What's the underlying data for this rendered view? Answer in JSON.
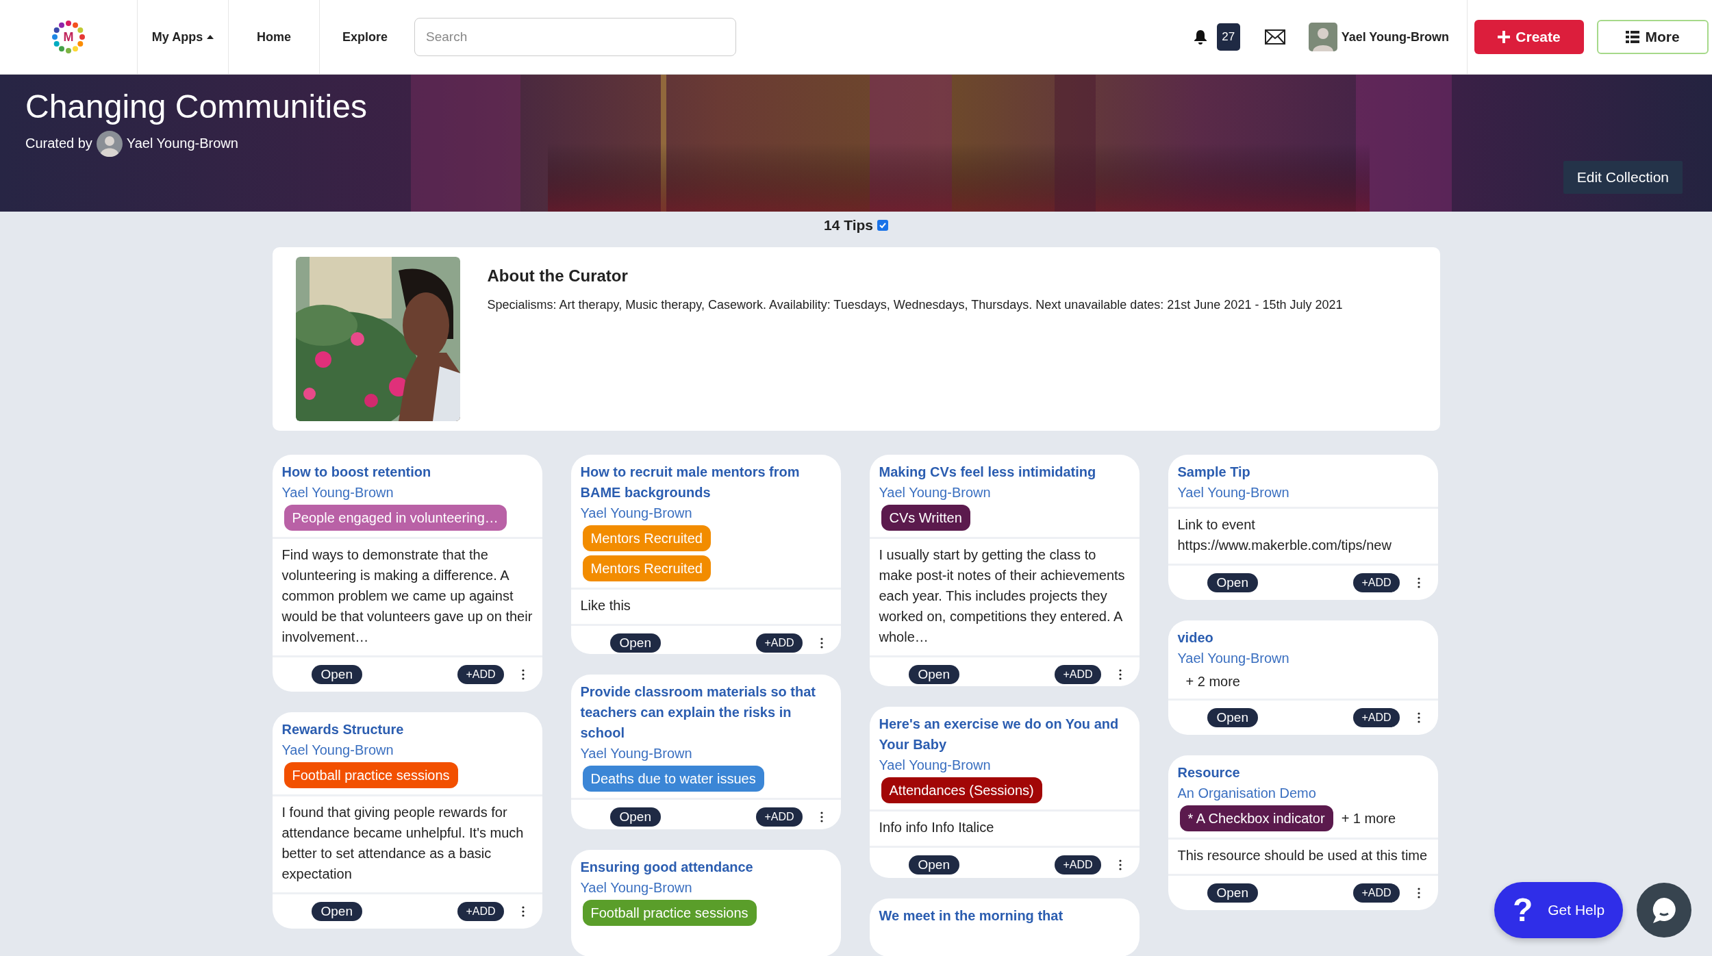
{
  "nav": {
    "logo_letter": "M",
    "items": [
      {
        "label": "My Apps",
        "dropdown": true
      },
      {
        "label": "Home",
        "dropdown": false
      },
      {
        "label": "Explore",
        "dropdown": false
      }
    ],
    "search": {
      "placeholder": "Search"
    },
    "notifications": "27",
    "user": {
      "name": "Yael Young-Brown"
    },
    "create_button": "Create",
    "more_button": "More"
  },
  "collection": {
    "title": "Changing Communities",
    "curated_by": "Curated by",
    "curator": "Yael Young-Brown",
    "edit_button": "Edit Collection"
  },
  "tips": {
    "count": "14 Tips",
    "checked": true
  },
  "about": {
    "title": "About the Curator",
    "text": "Specialisms: Art therapy, Music therapy, Casework. Availability: Tuesdays, Wednesdays, Thursdays. Next unavailable dates: 21st June 2021 - 15th July 2021"
  },
  "columns": [
    [
      {
        "title": "How to boost retention",
        "author": "Yael Young-Brown",
        "tags": [
          {
            "label": "People engaged in volunteering…",
            "color": "#b961a6"
          }
        ],
        "body": "Find ways to demonstrate that the volunteering is making a difference. A common problem we came up against would be that volunteers gave up on their involvement…",
        "open": "Open",
        "add": "+ADD"
      },
      {
        "title": "Rewards Structure",
        "author": "Yael Young-Brown",
        "tags": [
          {
            "label": "Football practice sessions",
            "color": "#f25000"
          }
        ],
        "body": "I found that giving people rewards for attendance became unhelpful. It's much better to set attendance as a basic expectation",
        "open": "Open",
        "add": "+ADD"
      }
    ],
    [
      {
        "title": "How to recruit male mentors from BAME backgrounds",
        "author": "Yael Young-Brown",
        "tags": [
          {
            "label": "Mentors Recruited",
            "color": "#f28c00"
          },
          {
            "label": "Mentors Recruited",
            "color": "#f28c00"
          }
        ],
        "body": "Like this",
        "open": "Open",
        "add": "+ADD"
      },
      {
        "title": "Provide classroom materials so that teachers can explain the risks in school",
        "author": "Yael Young-Brown",
        "tags": [
          {
            "label": "Deaths due to water issues",
            "color": "#3b86d6"
          }
        ],
        "open": "Open",
        "add": "+ADD"
      },
      {
        "title": "Ensuring good attendance",
        "author": "Yael Young-Brown",
        "tags": [
          {
            "label": "Football practice sessions",
            "color": "#5a9e2a"
          }
        ]
      }
    ],
    [
      {
        "title": "Making CVs feel less intimidating",
        "author": "Yael Young-Brown",
        "tags": [
          {
            "label": "CVs Written",
            "color": "#5b1a4d"
          }
        ],
        "body": "I usually start by getting the class to make post-it notes of their achievements each year. This includes projects they worked on, competitions they entered. A whole…",
        "open": "Open",
        "add": "+ADD"
      },
      {
        "title": "Here's an exercise we do on You and Your Baby",
        "author": "Yael Young-Brown",
        "tags": [
          {
            "label": "Attendances (Sessions)",
            "color": "#a20606"
          }
        ],
        "body": "Info info Info Italice",
        "open": "Open",
        "add": "+ADD"
      },
      {
        "title": "We meet in the morning that"
      }
    ],
    [
      {
        "title": "Sample Tip",
        "author": "Yael Young-Brown",
        "body": "Link to event https://www.makerble.com/tips/new",
        "open": "Open",
        "add": "+ADD"
      },
      {
        "title": "video",
        "author": "Yael Young-Brown",
        "more": "+ 2 more",
        "open": "Open",
        "add": "+ADD"
      },
      {
        "title": "Resource",
        "author": "An Organisation Demo",
        "tags": [
          {
            "label": "* A Checkbox indicator",
            "color": "#5b1a4d"
          }
        ],
        "more": "+ 1 more",
        "body": "This resource should be used at this time",
        "open": "Open",
        "add": "+ADD"
      }
    ]
  ],
  "help_button": {
    "icon": "?",
    "label": "Get Help"
  }
}
